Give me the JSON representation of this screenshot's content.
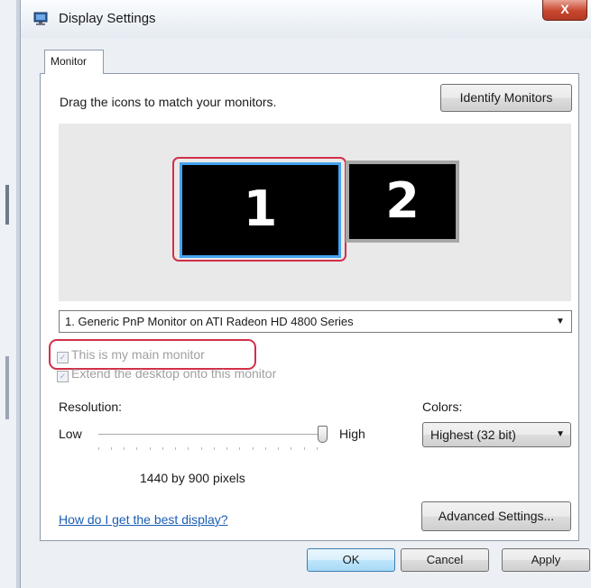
{
  "window": {
    "title": "Display Settings",
    "close_glyph": "X",
    "app_icon": "display-settings-icon"
  },
  "tabs": [
    {
      "label": "Monitor",
      "selected": true
    }
  ],
  "monitor_tab": {
    "instruction": "Drag the icons to match your monitors.",
    "identify_button": "Identify Monitors",
    "monitors": [
      {
        "number": "1",
        "selected": true
      },
      {
        "number": "2",
        "selected": false
      }
    ],
    "monitor_select": {
      "value": "1. Generic PnP Monitor on ATI Radeon HD 4800 Series"
    },
    "main_monitor_checkbox": {
      "label": "This is my main monitor",
      "checked": true,
      "enabled": false
    },
    "extend_checkbox": {
      "label": "Extend the desktop onto this monitor",
      "checked": true,
      "enabled": false
    },
    "resolution": {
      "label": "Resolution:",
      "low_label": "Low",
      "high_label": "High",
      "value_text": "1440 by 900 pixels",
      "slider_level": 1.0
    },
    "colors": {
      "label": "Colors:",
      "value": "Highest (32 bit)"
    },
    "help_link": "How do I get the best display?",
    "advanced_button": "Advanced Settings..."
  },
  "footer": {
    "ok": "OK",
    "cancel": "Cancel",
    "apply": "Apply"
  },
  "colors_theme": {
    "selection_outline": "#d2304a",
    "selected_monitor_border": "#44a3f0",
    "link": "#1a5db5"
  }
}
